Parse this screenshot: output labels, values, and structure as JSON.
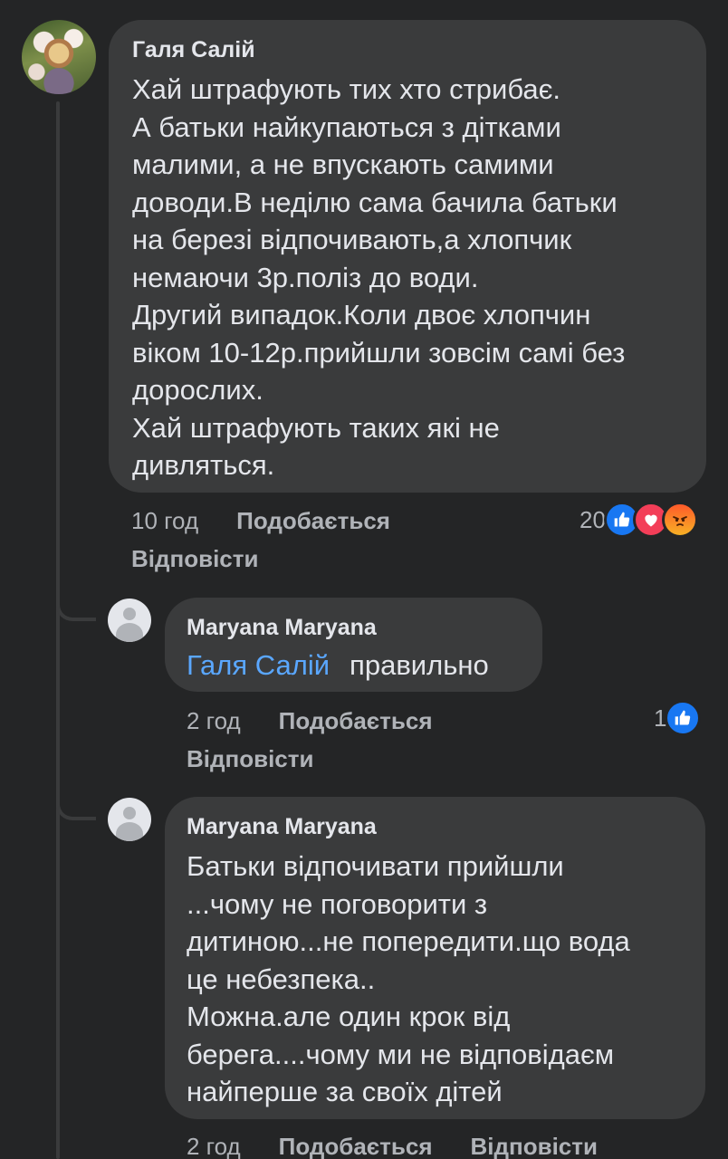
{
  "comments": [
    {
      "author": "Галя Салій",
      "lines": [
        "Хай штрафують тих хто стрибає.",
        "А батьки найкупаються з дітками",
        "малими, а не впускають самими",
        "доводи.В неділю сама бачила батьки",
        "на березі відпочивають,а хлопчик",
        "немаючи 3р.поліз до води.",
        "Другий випадок.Коли двоє хлопчин",
        "віком 10-12р.прийшли зовсім самі без",
        "дорослих.",
        "Хай штрафують таких які не",
        "дивляться."
      ],
      "time": "10 год",
      "like_label": "Подобається",
      "reply_label": "Відповісти",
      "reaction_count": "20",
      "reactions": [
        "like-icon",
        "love-icon",
        "angry-icon"
      ]
    },
    {
      "author": "Maryana Maryana",
      "mention": "Галя Салій",
      "text": "правильно",
      "time": "2 год",
      "like_label": "Подобається",
      "reply_label": "Відповісти",
      "reaction_count": "1",
      "reactions": [
        "like-icon"
      ]
    },
    {
      "author": "Maryana Maryana",
      "lines": [
        "Батьки відпочивати прийшли",
        "...чому не поговорити з",
        "дитиною...не попередити.що вода",
        "це небезпека..",
        "Можна.але один крок від",
        "берега....чому ми не відповідаєм",
        "найперше за своїх дітей"
      ],
      "time": "2 год",
      "like_label": "Подобається",
      "reply_label": "Відповісти"
    }
  ],
  "colors": {
    "background": "#242526",
    "bubble": "#3a3b3c",
    "mention": "#5aa7ff",
    "like": "#1877f2",
    "love": "#f33e58"
  }
}
